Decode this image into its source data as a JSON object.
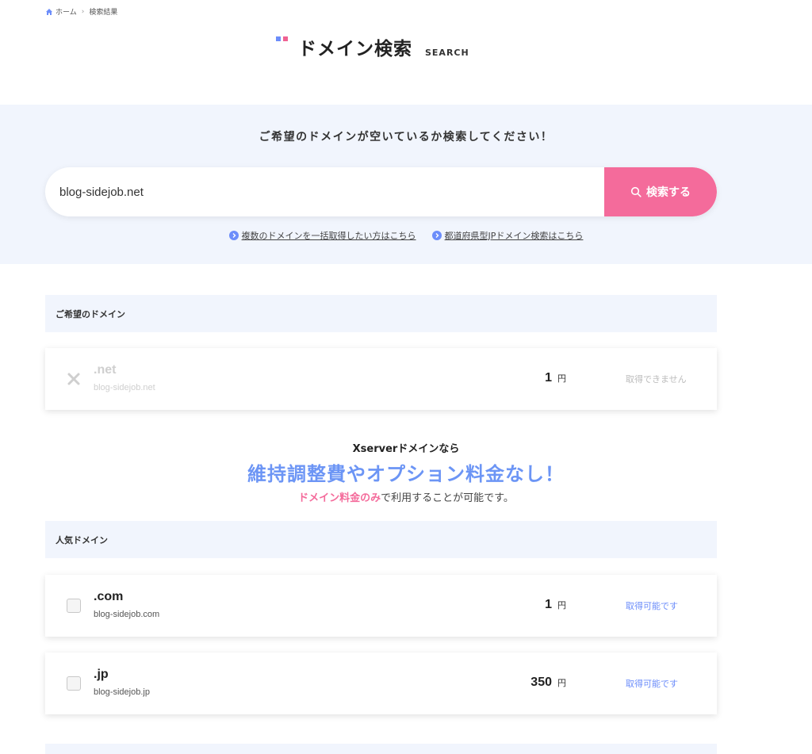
{
  "breadcrumb": {
    "home": "ホーム",
    "current": "検索結果"
  },
  "page": {
    "title": "ドメイン検索",
    "subtitle": "SEARCH"
  },
  "search": {
    "lead": "ご希望のドメインが空いているか検索してください！",
    "value": "blog-sidejob.net",
    "button_label": "検索する",
    "link_bulk": "複数のドメインを一括取得したい方はこちら",
    "link_pref": "都道府県型JPドメイン検索はこちら"
  },
  "requested": {
    "header": "ご希望のドメイン",
    "item": {
      "tld": ".net",
      "fqdn": "blog-sidejob.net",
      "price": "1",
      "unit": "円",
      "status": "取得できません"
    }
  },
  "promo": {
    "lead": "Xserverドメインなら",
    "main": "維持調整費やオプション料金なし！",
    "sub_highlight": "ドメイン料金のみ",
    "sub_rest": "で利用することが可能です。"
  },
  "popular": {
    "header": "人気ドメイン",
    "items": [
      {
        "tld": ".com",
        "fqdn": "blog-sidejob.com",
        "price": "1",
        "unit": "円",
        "status": "取得可能です"
      },
      {
        "tld": ".jp",
        "fqdn": "blog-sidejob.jp",
        "price": "350",
        "unit": "円",
        "status": "取得可能です"
      }
    ]
  },
  "colors": {
    "accent_blue": "#6c95f5",
    "accent_pink": "#f46b9b",
    "band_bg": "#f1f5fd"
  }
}
